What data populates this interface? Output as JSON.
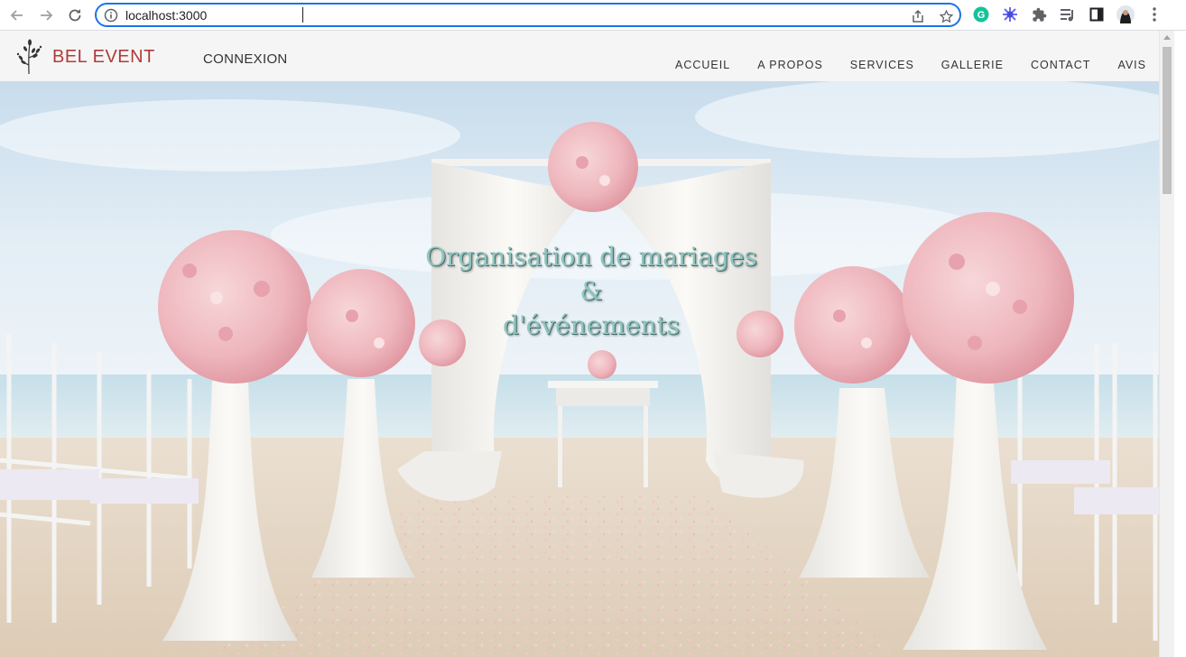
{
  "browser": {
    "url": "localhost:3000",
    "icons": [
      "back-arrow-icon",
      "forward-arrow-icon",
      "reload-icon",
      "info-icon",
      "share-icon",
      "star-icon",
      "grammarly-icon",
      "extension-flower-icon",
      "puzzle-icon",
      "media-queue-icon",
      "side-panel-icon",
      "profile-avatar",
      "kebab-menu-icon"
    ]
  },
  "header": {
    "brand": "BEL EVENT",
    "login": "CONNEXION",
    "nav": [
      "ACCUEIL",
      "A PROPOS",
      "SERVICES",
      "GALLERIE",
      "CONTACT",
      "AVIS"
    ]
  },
  "hero": {
    "title_line1": "Organisation de mariages",
    "title_line2": "&",
    "title_line3": "d'événements"
  },
  "colors": {
    "brand": "#b13a3a",
    "accent_focus": "#1a73e8",
    "hero_text": "#8fc5c1"
  }
}
